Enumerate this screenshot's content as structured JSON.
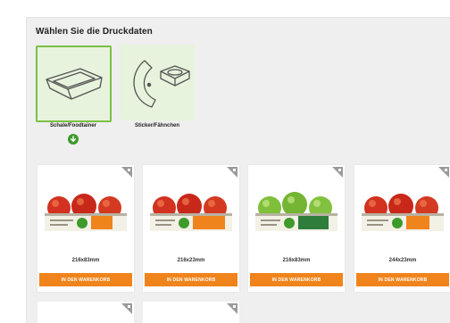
{
  "heading": "Wählen Sie die Druckdaten",
  "choices": [
    {
      "label": "Schale/Foodtainer",
      "icon": "tray-icon",
      "selected": true
    },
    {
      "label": "Sticker/Fähnchen",
      "icon": "sticker-icon",
      "selected": false
    }
  ],
  "selected_indicator_icon": "check-circle-icon",
  "products": [
    {
      "size": "216x83mm",
      "button": "IN DEN WARENKORB",
      "fruit": "red-apples",
      "label_color": "#f0841c"
    },
    {
      "size": "216x23mm",
      "button": "IN DEN WARENKORB",
      "fruit": "red-apples",
      "label_color": "#f0841c"
    },
    {
      "size": "216x83mm",
      "button": "IN DEN WARENKORB",
      "fruit": "green-apples",
      "label_color": "#3f9a2c"
    },
    {
      "size": "244x23mm",
      "button": "IN DEN WARENKORB",
      "fruit": "red-apples",
      "label_color": "#f0841c"
    }
  ],
  "colors": {
    "accent_orange": "#f0841c",
    "selected_green": "#7bbf46",
    "check_green": "#3f9a2c",
    "panel_bg": "#efefef"
  }
}
